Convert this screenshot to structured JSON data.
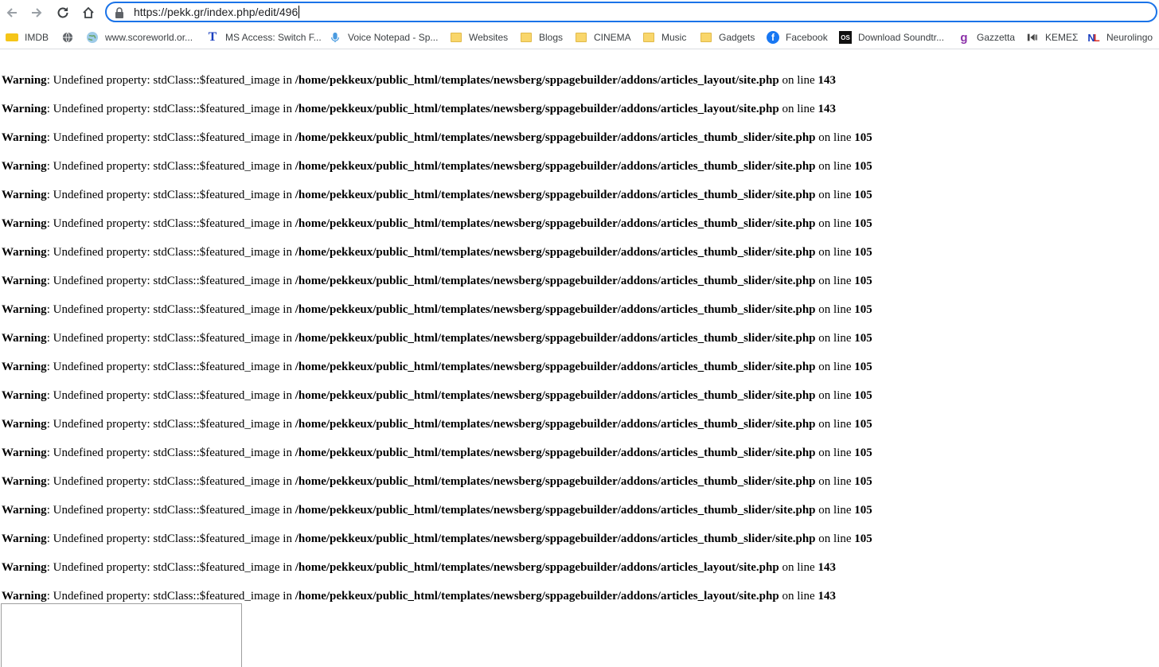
{
  "browser": {
    "url": "https://pekk.gr/index.php/edit/496",
    "bookmarks": [
      {
        "label": "IMDB",
        "icon": "imdb-icon"
      },
      {
        "label": "",
        "icon": "globe-icon"
      },
      {
        "label": "www.scoreworld.or...",
        "icon": "globe-icon"
      },
      {
        "label": "MS Access: Switch F...",
        "icon": "t-logo-icon"
      },
      {
        "label": "Voice Notepad - Sp...",
        "icon": "microphone-icon"
      },
      {
        "label": "Websites",
        "icon": "folder-icon"
      },
      {
        "label": "Blogs",
        "icon": "folder-icon"
      },
      {
        "label": "CINEMA",
        "icon": "folder-icon"
      },
      {
        "label": "Music",
        "icon": "folder-icon"
      },
      {
        "label": "Gadgets",
        "icon": "folder-icon"
      },
      {
        "label": "Facebook",
        "icon": "facebook-icon"
      },
      {
        "label": "Download Soundtr...",
        "icon": "ost-icon"
      },
      {
        "label": "Gazzetta",
        "icon": "gazzetta-icon"
      },
      {
        "label": "ΚΕΜΕΣ",
        "icon": "kemes-icon"
      },
      {
        "label": "Neurolingo",
        "icon": "nl-icon"
      }
    ]
  },
  "warnings": [
    {
      "prefix": "Warning",
      "message": ": Undefined property: stdClass::$featured_image in ",
      "path": "/home/pekkeux/public_html/templates/newsberg/sppagebuilder/addons/articles_layout/site.php",
      "online": " on line ",
      "line": "143"
    },
    {
      "prefix": "Warning",
      "message": ": Undefined property: stdClass::$featured_image in ",
      "path": "/home/pekkeux/public_html/templates/newsberg/sppagebuilder/addons/articles_layout/site.php",
      "online": " on line ",
      "line": "143"
    },
    {
      "prefix": "Warning",
      "message": ": Undefined property: stdClass::$featured_image in ",
      "path": "/home/pekkeux/public_html/templates/newsberg/sppagebuilder/addons/articles_thumb_slider/site.php",
      "online": " on line ",
      "line": "105"
    },
    {
      "prefix": "Warning",
      "message": ": Undefined property: stdClass::$featured_image in ",
      "path": "/home/pekkeux/public_html/templates/newsberg/sppagebuilder/addons/articles_thumb_slider/site.php",
      "online": " on line ",
      "line": "105"
    },
    {
      "prefix": "Warning",
      "message": ": Undefined property: stdClass::$featured_image in ",
      "path": "/home/pekkeux/public_html/templates/newsberg/sppagebuilder/addons/articles_thumb_slider/site.php",
      "online": " on line ",
      "line": "105"
    },
    {
      "prefix": "Warning",
      "message": ": Undefined property: stdClass::$featured_image in ",
      "path": "/home/pekkeux/public_html/templates/newsberg/sppagebuilder/addons/articles_thumb_slider/site.php",
      "online": " on line ",
      "line": "105"
    },
    {
      "prefix": "Warning",
      "message": ": Undefined property: stdClass::$featured_image in ",
      "path": "/home/pekkeux/public_html/templates/newsberg/sppagebuilder/addons/articles_thumb_slider/site.php",
      "online": " on line ",
      "line": "105"
    },
    {
      "prefix": "Warning",
      "message": ": Undefined property: stdClass::$featured_image in ",
      "path": "/home/pekkeux/public_html/templates/newsberg/sppagebuilder/addons/articles_thumb_slider/site.php",
      "online": " on line ",
      "line": "105"
    },
    {
      "prefix": "Warning",
      "message": ": Undefined property: stdClass::$featured_image in ",
      "path": "/home/pekkeux/public_html/templates/newsberg/sppagebuilder/addons/articles_thumb_slider/site.php",
      "online": " on line ",
      "line": "105"
    },
    {
      "prefix": "Warning",
      "message": ": Undefined property: stdClass::$featured_image in ",
      "path": "/home/pekkeux/public_html/templates/newsberg/sppagebuilder/addons/articles_thumb_slider/site.php",
      "online": " on line ",
      "line": "105"
    },
    {
      "prefix": "Warning",
      "message": ": Undefined property: stdClass::$featured_image in ",
      "path": "/home/pekkeux/public_html/templates/newsberg/sppagebuilder/addons/articles_thumb_slider/site.php",
      "online": " on line ",
      "line": "105"
    },
    {
      "prefix": "Warning",
      "message": ": Undefined property: stdClass::$featured_image in ",
      "path": "/home/pekkeux/public_html/templates/newsberg/sppagebuilder/addons/articles_thumb_slider/site.php",
      "online": " on line ",
      "line": "105"
    },
    {
      "prefix": "Warning",
      "message": ": Undefined property: stdClass::$featured_image in ",
      "path": "/home/pekkeux/public_html/templates/newsberg/sppagebuilder/addons/articles_thumb_slider/site.php",
      "online": " on line ",
      "line": "105"
    },
    {
      "prefix": "Warning",
      "message": ": Undefined property: stdClass::$featured_image in ",
      "path": "/home/pekkeux/public_html/templates/newsberg/sppagebuilder/addons/articles_thumb_slider/site.php",
      "online": " on line ",
      "line": "105"
    },
    {
      "prefix": "Warning",
      "message": ": Undefined property: stdClass::$featured_image in ",
      "path": "/home/pekkeux/public_html/templates/newsberg/sppagebuilder/addons/articles_thumb_slider/site.php",
      "online": " on line ",
      "line": "105"
    },
    {
      "prefix": "Warning",
      "message": ": Undefined property: stdClass::$featured_image in ",
      "path": "/home/pekkeux/public_html/templates/newsberg/sppagebuilder/addons/articles_thumb_slider/site.php",
      "online": " on line ",
      "line": "105"
    },
    {
      "prefix": "Warning",
      "message": ": Undefined property: stdClass::$featured_image in ",
      "path": "/home/pekkeux/public_html/templates/newsberg/sppagebuilder/addons/articles_thumb_slider/site.php",
      "online": " on line ",
      "line": "105"
    },
    {
      "prefix": "Warning",
      "message": ": Undefined property: stdClass::$featured_image in ",
      "path": "/home/pekkeux/public_html/templates/newsberg/sppagebuilder/addons/articles_layout/site.php",
      "online": " on line ",
      "line": "143"
    },
    {
      "prefix": "Warning",
      "message": ": Undefined property: stdClass::$featured_image in ",
      "path": "/home/pekkeux/public_html/templates/newsberg/sppagebuilder/addons/articles_layout/site.php",
      "online": " on line ",
      "line": "143"
    }
  ],
  "colors": {
    "accent": "#1a73e8",
    "folder": "#f9d66b",
    "facebook": "#1877f2"
  }
}
